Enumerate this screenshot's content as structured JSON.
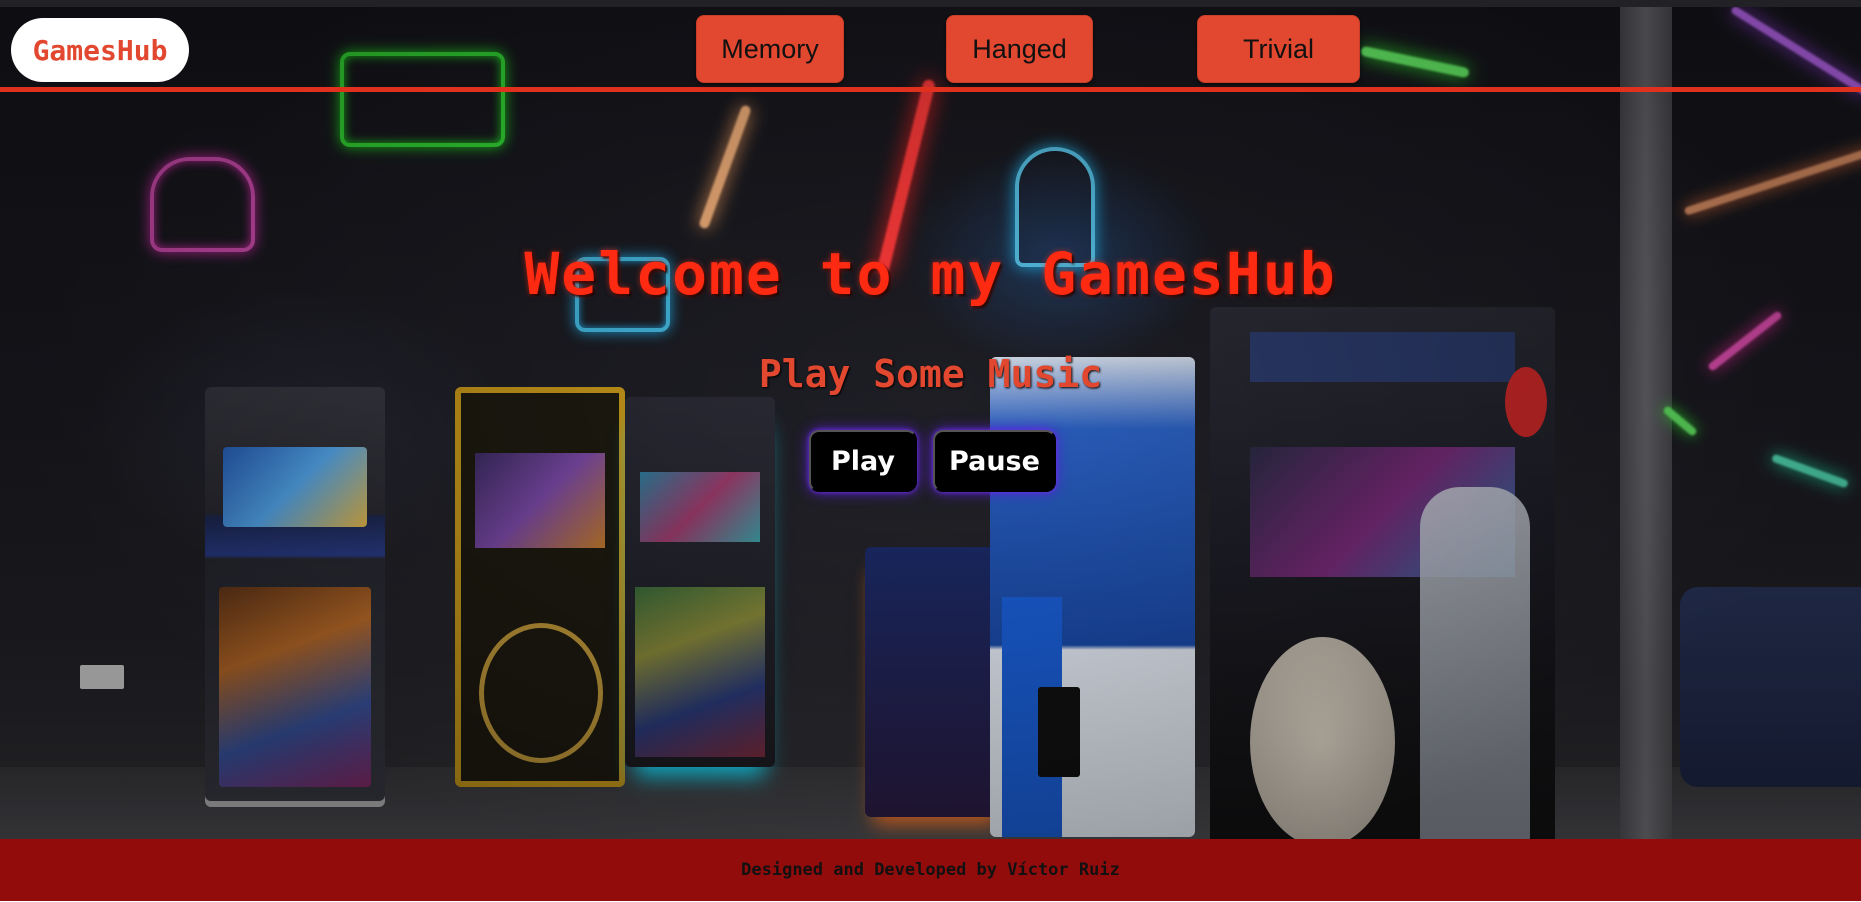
{
  "brand": {
    "logo_text": "GamesHub"
  },
  "nav": {
    "items": [
      {
        "label": "Memory"
      },
      {
        "label": "Hanged"
      },
      {
        "label": "Trivial"
      }
    ]
  },
  "hero": {
    "title": "Welcome to my GamesHub",
    "subtitle": "Play Some Music",
    "controls": {
      "play_label": "Play",
      "pause_label": "Pause"
    }
  },
  "footer": {
    "credit": "Designed and Developed by Víctor Ruiz"
  },
  "colors": {
    "accent": "#e2472f",
    "title_red": "#ff2a12",
    "footer_bg": "#930c0c",
    "button_glow": "#5b1fd8"
  }
}
